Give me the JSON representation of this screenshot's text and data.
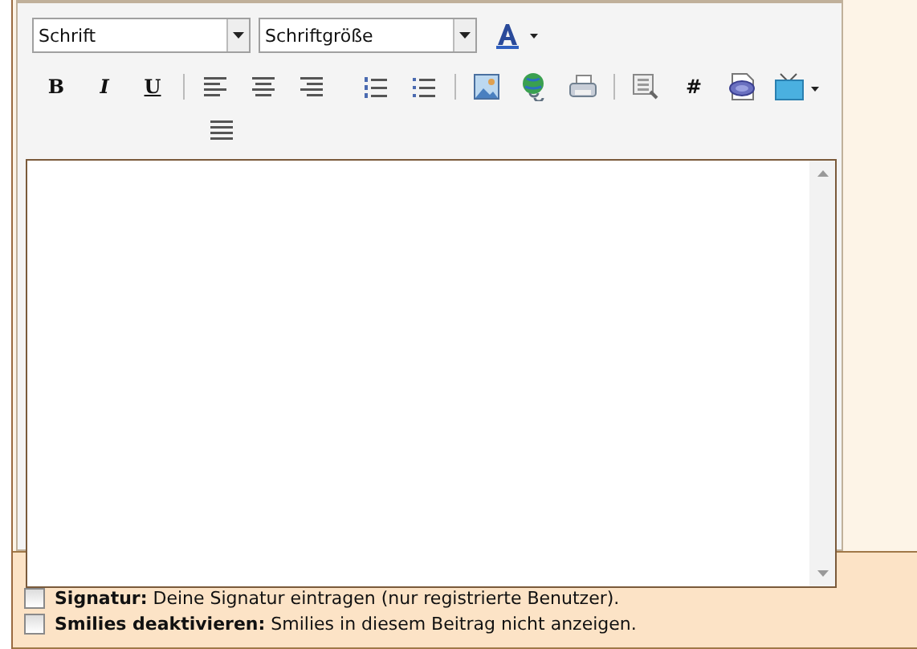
{
  "toolbar": {
    "font_select": {
      "value": "Schrift"
    },
    "size_select": {
      "value": "Schriftgröße"
    },
    "rows": [
      [
        {
          "kind": "font-color"
        }
      ],
      [
        {
          "kind": "bold",
          "label": "B"
        },
        {
          "kind": "italic",
          "label": "I"
        },
        {
          "kind": "underline",
          "label": "U"
        },
        {
          "kind": "separator"
        },
        {
          "kind": "align-left"
        },
        {
          "kind": "align-center"
        },
        {
          "kind": "align-right"
        },
        {
          "kind": "gap"
        },
        {
          "kind": "ordered-list"
        },
        {
          "kind": "bullet-list"
        },
        {
          "kind": "separator"
        },
        {
          "kind": "image"
        },
        {
          "kind": "globe"
        },
        {
          "kind": "printer"
        },
        {
          "kind": "separator"
        },
        {
          "kind": "find"
        },
        {
          "kind": "hash",
          "label": "#"
        },
        {
          "kind": "php"
        },
        {
          "kind": "tv"
        }
      ],
      [
        {
          "kind": "justify"
        }
      ]
    ]
  },
  "options": [
    {
      "label": "Signatur:",
      "text": "Deine Signatur eintragen (nur registrierte Benutzer).",
      "checked": false
    },
    {
      "label": "Smilies deaktivieren:",
      "text": "Smilies in diesem Beitrag nicht anzeigen.",
      "checked": false
    }
  ]
}
